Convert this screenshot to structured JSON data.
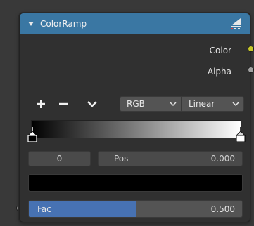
{
  "node": {
    "title": "ColorRamp",
    "header_color": "#3a77a3"
  },
  "outputs": [
    {
      "label": "Color",
      "socket_color": "#c7c729"
    },
    {
      "label": "Alpha",
      "socket_color": "#a1a1a1"
    }
  ],
  "toolbar": {
    "add_icon": "plus-icon",
    "remove_icon": "minus-icon",
    "menu_icon": "chevron-down-icon",
    "color_mode": "RGB",
    "interpolation": "Linear"
  },
  "ramp": {
    "start_color": "#000000",
    "end_color": "#ffffff",
    "stops": [
      {
        "position": 0.0,
        "color": "#000000",
        "active": true
      },
      {
        "position": 1.0,
        "color": "#ffffff",
        "active": false
      }
    ]
  },
  "stop_fields": {
    "index": "0",
    "pos_label": "Pos",
    "pos_value": "0.000"
  },
  "current_color": "#000000",
  "inputs": {
    "fac_label": "Fac",
    "fac_value": "0.500",
    "fac_fraction": 0.5,
    "accent": "#4772b3"
  }
}
